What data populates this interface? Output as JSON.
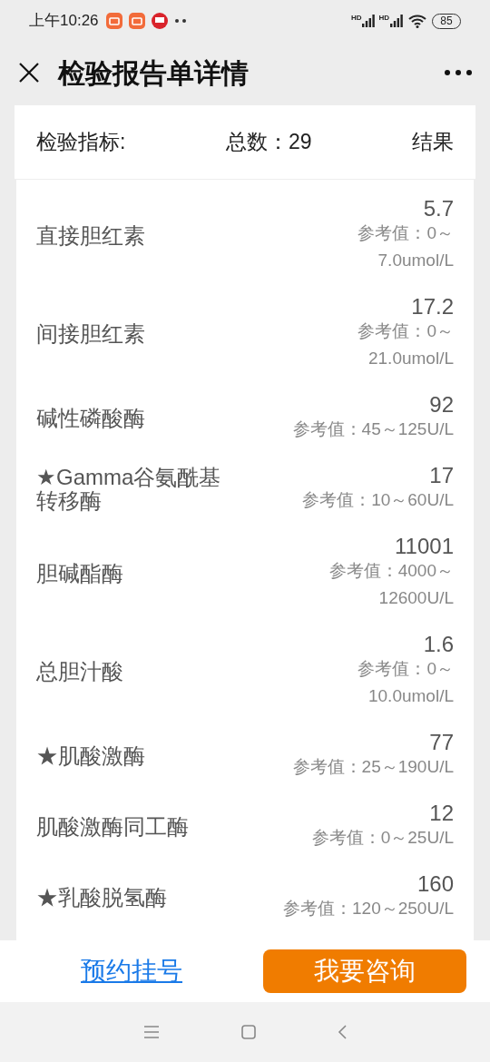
{
  "status_bar": {
    "time": "上午10:26",
    "signal_labels": [
      "HD",
      "HD"
    ],
    "battery": "85"
  },
  "header": {
    "title": "检验报告单详情"
  },
  "summary": {
    "label": "检验指标:",
    "total": "总数：29",
    "result_label": "结果"
  },
  "items": [
    {
      "name_lines": [
        "直接胆红素"
      ],
      "value": "5.7",
      "reference_lines": [
        "参考值：0～",
        "7.0umol/L"
      ]
    },
    {
      "name_lines": [
        "间接胆红素"
      ],
      "value": "17.2",
      "reference_lines": [
        "参考值：0～",
        "21.0umol/L"
      ]
    },
    {
      "name_lines": [
        "碱性磷酸酶"
      ],
      "value": "92",
      "reference_lines": [
        "参考值：45～125U/L"
      ]
    },
    {
      "name_lines": [
        "★Gamma谷氨酰基",
        "转移酶"
      ],
      "value": "17",
      "reference_lines": [
        "参考值：10～60U/L"
      ]
    },
    {
      "name_lines": [
        "胆碱酯酶"
      ],
      "value": "11001",
      "reference_lines": [
        "参考值：4000～",
        "12600U/L"
      ]
    },
    {
      "name_lines": [
        "总胆汁酸"
      ],
      "value": "1.6",
      "reference_lines": [
        "参考值：0～",
        "10.0umol/L"
      ]
    },
    {
      "name_lines": [
        "★肌酸激酶"
      ],
      "value": "77",
      "reference_lines": [
        "参考值：25～190U/L"
      ]
    },
    {
      "name_lines": [
        "肌酸激酶同工酶"
      ],
      "value": "12",
      "reference_lines": [
        "参考值：0～25U/L"
      ]
    },
    {
      "name_lines": [
        "★乳酸脱氢酶"
      ],
      "value": "160",
      "reference_lines": [
        "参考值：120～250U/L"
      ]
    }
  ],
  "footer": {
    "link": "预约挂号",
    "button": "我要咨询"
  }
}
